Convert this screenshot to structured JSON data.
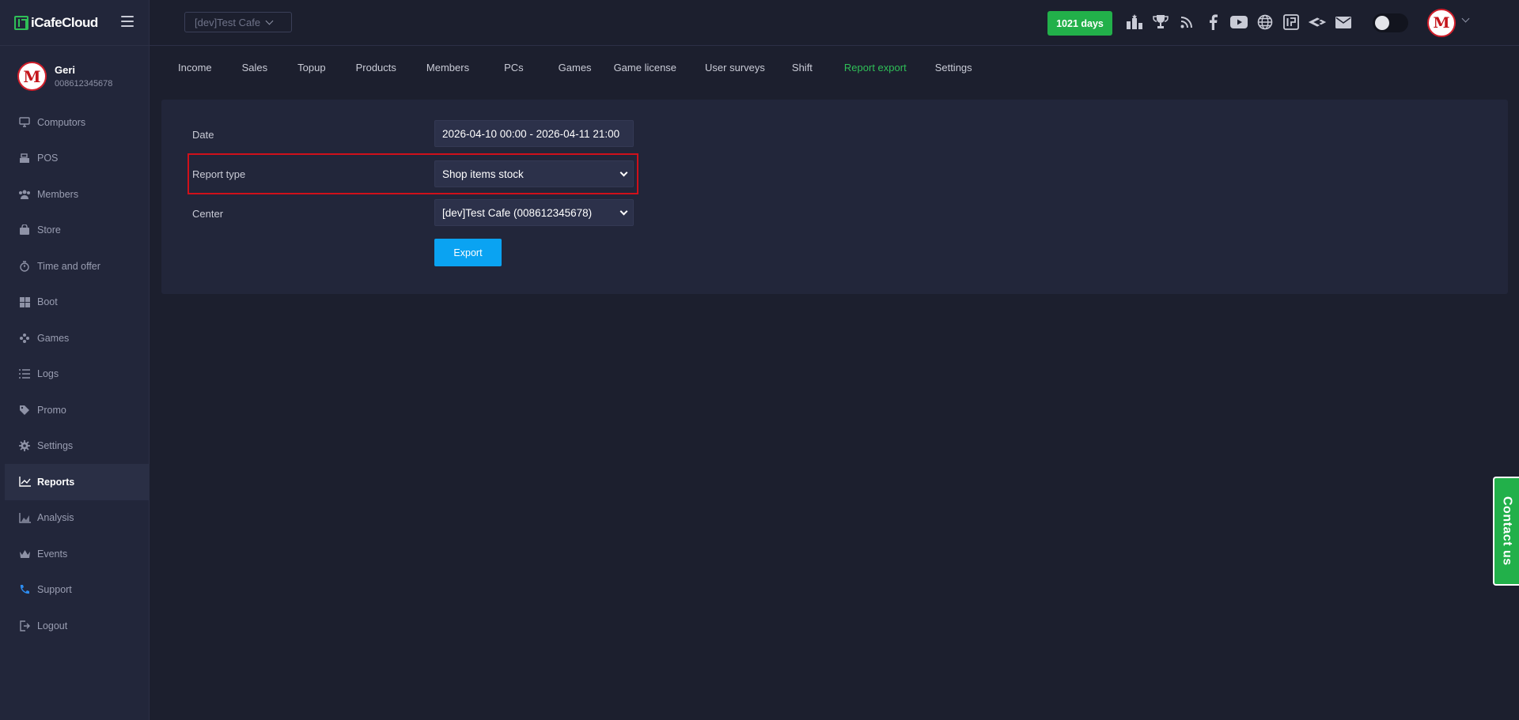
{
  "brand": {
    "name": "iCafeCloud"
  },
  "topbar": {
    "cafe_name": "[dev]Test Cafe",
    "days": "1021 days",
    "icons": [
      "ranking-icon",
      "trophy-icon",
      "rss-icon",
      "facebook-icon",
      "youtube-icon",
      "globe-icon",
      "icafe-icon",
      "wings-icon",
      "mail-icon"
    ]
  },
  "profile": {
    "name": "Geri",
    "id": "008612345678"
  },
  "sidebar": {
    "items": [
      {
        "label": "Computors",
        "icon": "monitor-icon"
      },
      {
        "label": "POS",
        "icon": "register-icon"
      },
      {
        "label": "Members",
        "icon": "users-icon"
      },
      {
        "label": "Store",
        "icon": "bag-icon"
      },
      {
        "label": "Time and offer",
        "icon": "stopwatch-icon"
      },
      {
        "label": "Boot",
        "icon": "windows-icon"
      },
      {
        "label": "Games",
        "icon": "gamepad-icon"
      },
      {
        "label": "Logs",
        "icon": "list-icon"
      },
      {
        "label": "Promo",
        "icon": "tag-icon"
      },
      {
        "label": "Settings",
        "icon": "gear-icon"
      },
      {
        "label": "Reports",
        "icon": "chart-line-icon"
      },
      {
        "label": "Analysis",
        "icon": "area-chart-icon"
      },
      {
        "label": "Events",
        "icon": "crown-icon"
      },
      {
        "label": "Support",
        "icon": "phone-icon"
      },
      {
        "label": "Logout",
        "icon": "logout-icon"
      }
    ],
    "active": "Reports"
  },
  "tabs": [
    "Income",
    "Sales",
    "Topup",
    "Products",
    "Members",
    "PCs",
    "Games",
    "Game license",
    "User surveys",
    "Shift",
    "Report export",
    "Settings"
  ],
  "active_tab": "Report export",
  "form": {
    "date_label": "Date",
    "date_value": "2026-04-10 00:00 - 2026-04-11 21:00",
    "report_type_label": "Report type",
    "report_type_value": "Shop items stock",
    "center_label": "Center",
    "center_value": "[dev]Test Cafe (008612345678)",
    "export_label": "Export"
  },
  "contact": {
    "label": "Contact us"
  },
  "colors": {
    "accent_green": "#22b04a",
    "accent_blue": "#0aa3f2",
    "highlight_red": "#d0101a",
    "bg": "#1c1f2e",
    "panel": "#22263a"
  }
}
